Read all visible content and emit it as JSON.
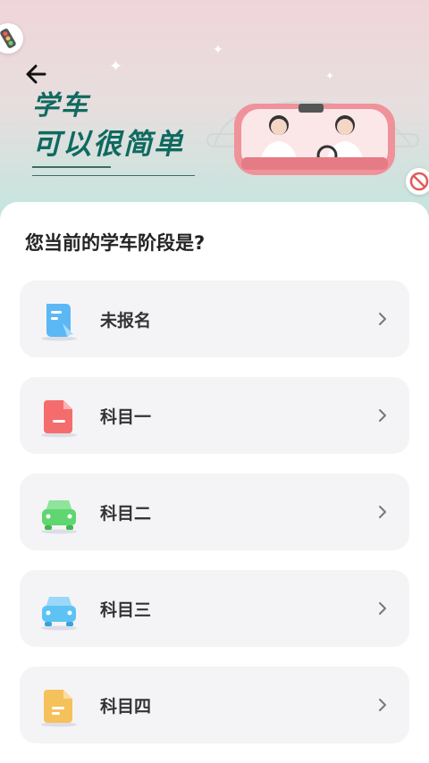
{
  "header": {
    "slogan_line1": "学车",
    "slogan_line2": "可以很简单",
    "back_icon": "arrow-left-icon"
  },
  "question": "您当前的学车阶段是?",
  "options": [
    {
      "label": "未报名",
      "icon": "document-icon",
      "color": "#5bb8f5"
    },
    {
      "label": "科目一",
      "icon": "file-icon",
      "color": "#f56c6c"
    },
    {
      "label": "科目二",
      "icon": "car-icon",
      "color": "#5fd66f"
    },
    {
      "label": "科目三",
      "icon": "car-icon",
      "color": "#5ec2f5"
    },
    {
      "label": "科目四",
      "icon": "file-icon",
      "color": "#f5c15b"
    }
  ],
  "colors": {
    "slogan": "#0f6a60",
    "card_bg": "#f4f4f7",
    "hero_top": "#efd5d9",
    "hero_bottom": "#bfe6df"
  }
}
